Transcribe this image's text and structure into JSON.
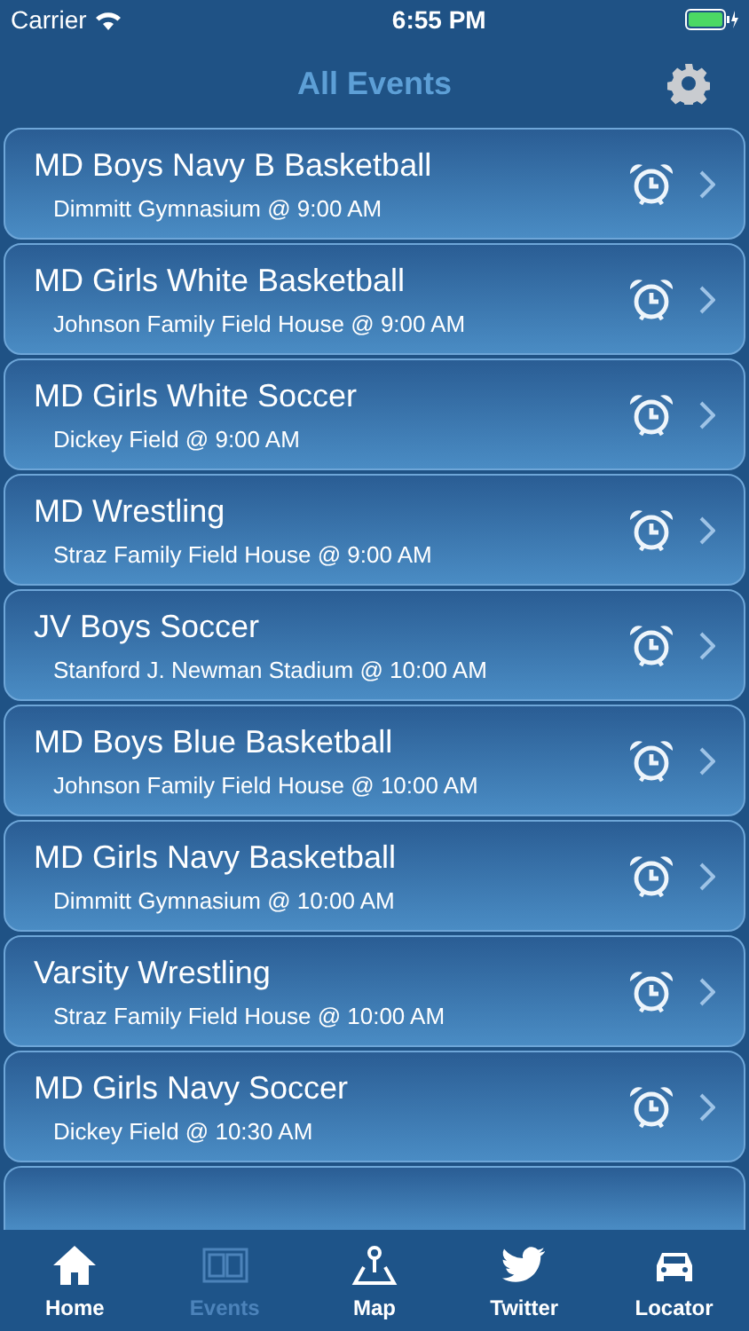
{
  "status_bar": {
    "carrier": "Carrier",
    "time": "6:55 PM"
  },
  "nav": {
    "title": "All Events"
  },
  "events": [
    {
      "title": "MD Boys Navy B Basketball",
      "subtitle": "Dimmitt Gymnasium @ 9:00 AM"
    },
    {
      "title": "MD Girls White Basketball",
      "subtitle": "Johnson Family Field House @ 9:00 AM"
    },
    {
      "title": "MD Girls White Soccer",
      "subtitle": "Dickey Field @ 9:00 AM"
    },
    {
      "title": "MD Wrestling",
      "subtitle": "Straz Family Field House @ 9:00 AM"
    },
    {
      "title": "JV Boys Soccer",
      "subtitle": "Stanford J. Newman Stadium @ 10:00 AM"
    },
    {
      "title": "MD Boys Blue Basketball",
      "subtitle": "Johnson Family Field House @ 10:00 AM"
    },
    {
      "title": "MD Girls Navy Basketball",
      "subtitle": "Dimmitt Gymnasium @ 10:00 AM"
    },
    {
      "title": "Varsity Wrestling",
      "subtitle": "Straz Family Field House @ 10:00 AM"
    },
    {
      "title": "MD Girls Navy Soccer",
      "subtitle": "Dickey Field @ 10:30 AM"
    }
  ],
  "tabs": [
    {
      "label": "Home",
      "kind": "home",
      "selected": false
    },
    {
      "label": "Events",
      "kind": "events",
      "selected": true
    },
    {
      "label": "Map",
      "kind": "map",
      "selected": false
    },
    {
      "label": "Twitter",
      "kind": "bird",
      "selected": false
    },
    {
      "label": "Locator",
      "kind": "car",
      "selected": false
    }
  ]
}
